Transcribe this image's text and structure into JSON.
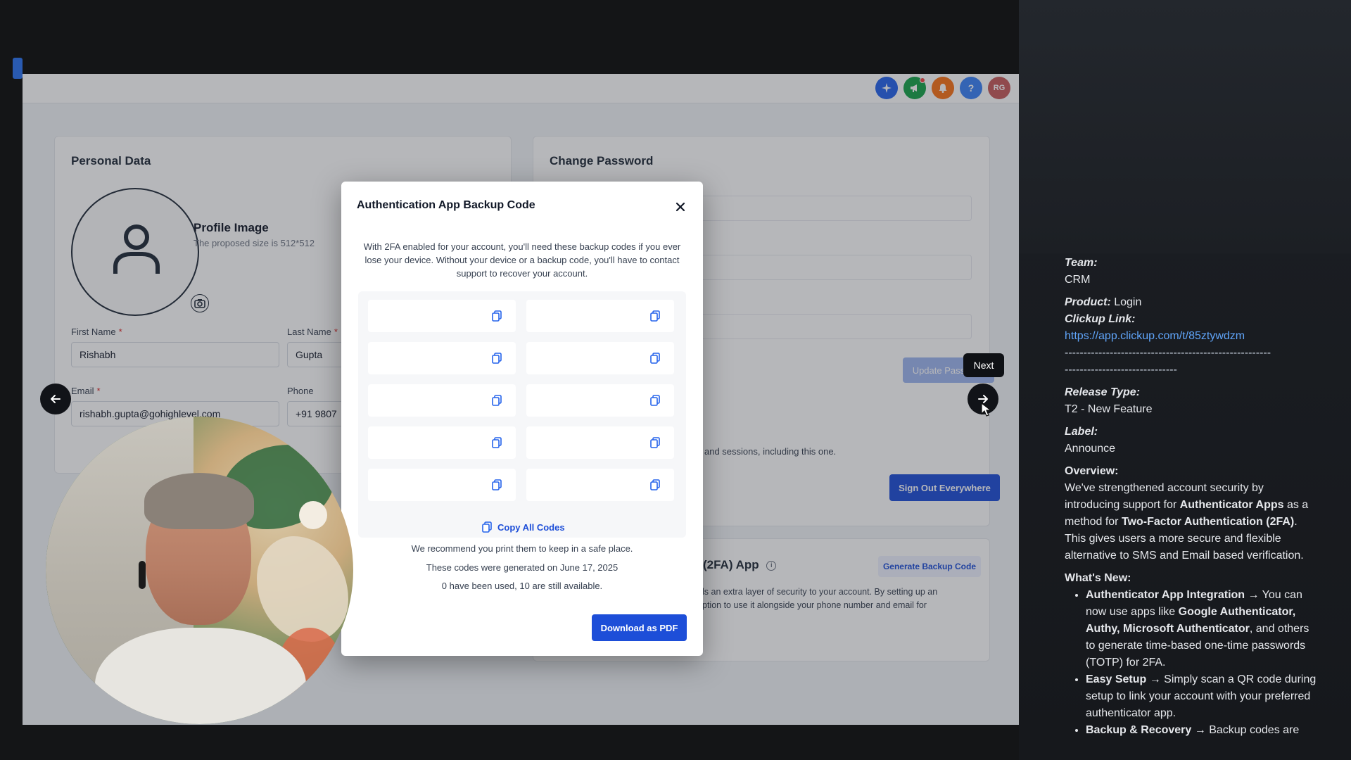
{
  "topbar": {
    "icons": [
      {
        "name": "ai-sparkle-icon",
        "color": "#2563eb"
      },
      {
        "name": "megaphone-icon",
        "color": "#16a34a"
      },
      {
        "name": "bell-icon",
        "color": "#f97316"
      },
      {
        "name": "help-icon",
        "color": "#3b82f6",
        "glyph": "?"
      },
      {
        "name": "user-avatar",
        "color": "#c65a5a",
        "glyph": "RG"
      }
    ]
  },
  "personal": {
    "title": "Personal Data",
    "profile_image_label": "Profile Image",
    "profile_image_hint": "The proposed size is 512*512",
    "first_name_label": "First Name",
    "first_name_value": "Rishabh",
    "last_name_label": "Last Name",
    "last_name_value": "Gupta",
    "email_label": "Email",
    "email_value": "rishabh.gupta@gohighlevel.com",
    "phone_label": "Phone",
    "phone_value": "+91 9807"
  },
  "password": {
    "title": "Change Password",
    "update_button": "Update Password"
  },
  "sessions": {
    "text": "and sessions, including this one.",
    "signout_button": "Sign Out Everywhere"
  },
  "twofa": {
    "title": "(2FA) App",
    "generate_button": "Generate Backup Code",
    "desc_line1": "ls an extra layer of security to your account. By setting up an",
    "desc_line2": "ption to use it alongside your phone number and email for"
  },
  "modal": {
    "title": "Authentication App Backup Code",
    "description": "With 2FA enabled for your account, you'll need these backup codes if you ever lose your device. Without your device or a backup code, you'll have to contact support to recover your account.",
    "codes": [
      "",
      "",
      "",
      "",
      "",
      "",
      "",
      "",
      "",
      ""
    ],
    "copy_all": "Copy All Codes",
    "info1": "We recommend you print them to keep in a safe place.",
    "info2": "These codes were generated on June 17, 2025",
    "info3": "0 have been used, 10 are still available.",
    "download_button": "Download as PDF"
  },
  "nav": {
    "next_tooltip": "Next"
  },
  "notes": {
    "team_label": "Team:",
    "team_value": "CRM",
    "product_label": "Product:",
    "product_value": "Login",
    "clickup_label": "Clickup Link:",
    "clickup_url": "https://app.clickup.com/t/85ztywdzm",
    "rule1": "-------------------------------------------------------",
    "rule2": "------------------------------",
    "release_label": "Release Type:",
    "release_value": "T2 - New Feature",
    "label_label": "Label:",
    "label_value": "Announce",
    "overview_label": "Overview:",
    "overview": {
      "p1": "We've strengthened account security by introducing support for ",
      "b1": "Authenticator Apps",
      "p2": " as a method for ",
      "b2": "Two-Factor Authentication (2FA)",
      "p3": ". This gives users a more secure and flexible alternative to SMS and Email based verification."
    },
    "whats_new_label": "What's New:",
    "items": [
      {
        "title": "Authenticator App Integration",
        "arrow": " → ",
        "p1": "You can now use apps like ",
        "b1": "Google Authenticator, Authy, Microsoft Authenticator",
        "p2": ", and others to generate time-based one-time passwords (TOTP) for 2FA."
      },
      {
        "title": "Easy Setup",
        "arrow": " → ",
        "p1": "Simply scan a QR code during setup to link your account with your preferred authenticator app.",
        "b1": "",
        "p2": ""
      },
      {
        "title": "Backup & Recovery",
        "arrow": " → ",
        "p1": "Backup codes are",
        "b1": "",
        "p2": ""
      }
    ]
  }
}
